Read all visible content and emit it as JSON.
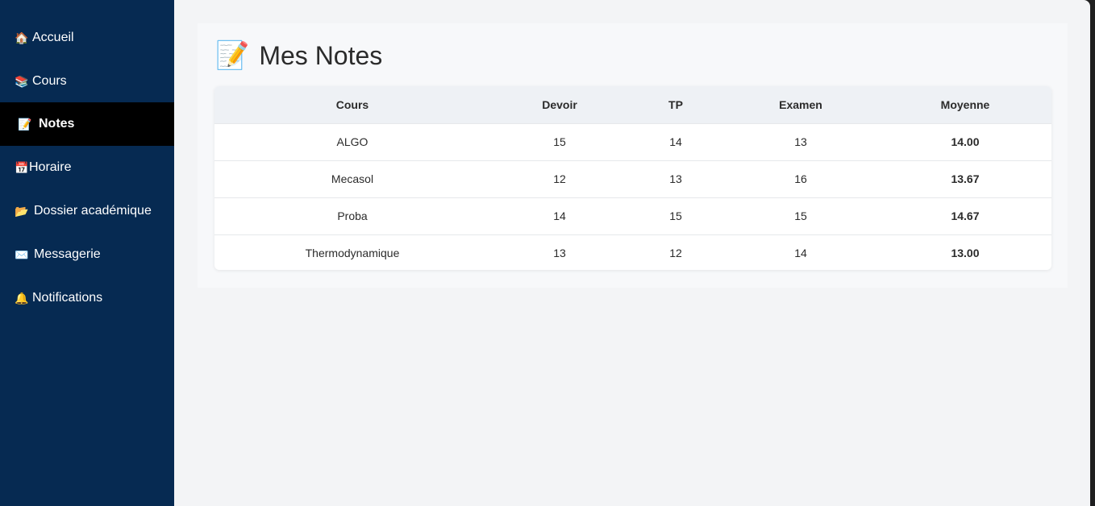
{
  "sidebar": {
    "items": [
      {
        "icon": "🏠",
        "icon_name": "home-icon",
        "label": "Accueil"
      },
      {
        "icon": "📚",
        "icon_name": "books-icon",
        "label": "Cours"
      },
      {
        "icon": "📝",
        "icon_name": "memo-icon",
        "label": "Notes",
        "active": true
      },
      {
        "icon": "📅",
        "icon_name": "calendar-icon",
        "label": "Horaire"
      },
      {
        "icon": "📂",
        "icon_name": "folder-icon",
        "label": "Dossier académique"
      },
      {
        "icon": "✉️",
        "icon_name": "envelope-icon",
        "label": "Messagerie"
      },
      {
        "icon": "🔔",
        "icon_name": "bell-icon",
        "label": "Notifications"
      }
    ]
  },
  "page": {
    "title_icon": "📝",
    "title": "Mes Notes"
  },
  "table": {
    "headers": [
      "Cours",
      "Devoir",
      "TP",
      "Examen",
      "Moyenne"
    ],
    "rows": [
      [
        "ALGO",
        "15",
        "14",
        "13",
        "14.00"
      ],
      [
        "Mecasol",
        "12",
        "13",
        "16",
        "13.67"
      ],
      [
        "Proba",
        "14",
        "15",
        "15",
        "14.67"
      ],
      [
        "Thermodynamique",
        "13",
        "12",
        "14",
        "13.00"
      ]
    ]
  },
  "colors": {
    "sidebar_bg": "#062a52",
    "active_bg": "#000000",
    "main_bg": "#f3f4f6"
  }
}
